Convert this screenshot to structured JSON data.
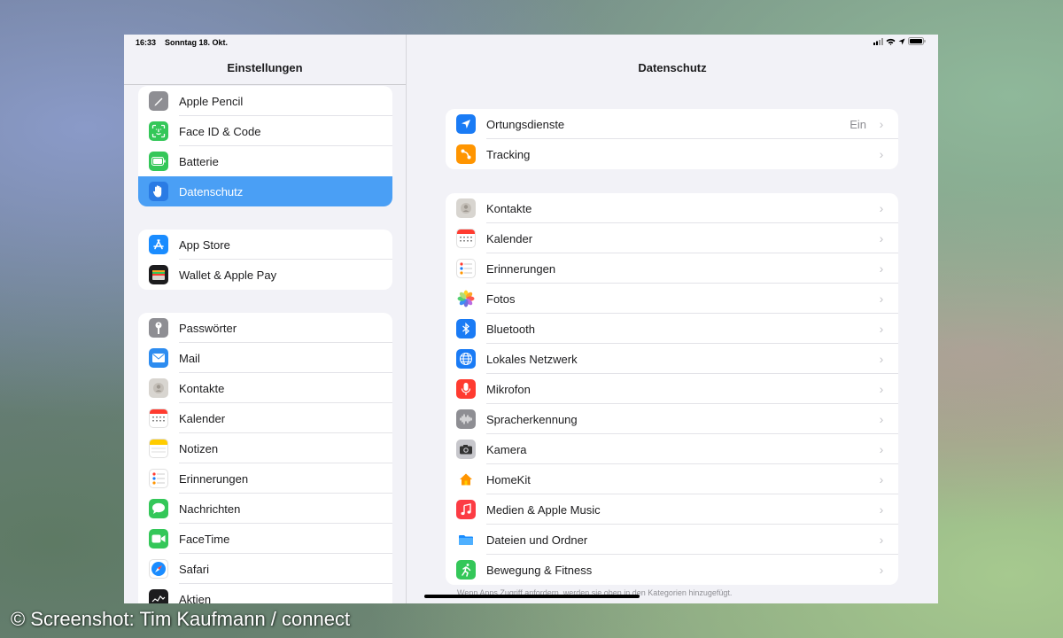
{
  "status_bar": {
    "time": "16:33",
    "date": "Sonntag 18. Okt."
  },
  "sidebar": {
    "title": "Einstellungen",
    "groups": [
      [
        {
          "label": "Apple Pencil",
          "icon": "pencil-icon",
          "color": "#8e8e93"
        },
        {
          "label": "Face ID & Code",
          "icon": "faceid-icon",
          "color": "#34c759"
        },
        {
          "label": "Batterie",
          "icon": "battery-icon",
          "color": "#34c759"
        },
        {
          "label": "Datenschutz",
          "icon": "hand-icon",
          "color": "#2a7be4",
          "selected": true
        }
      ],
      [
        {
          "label": "App Store",
          "icon": "appstore-icon",
          "color": "#1a8cff"
        },
        {
          "label": "Wallet & Apple Pay",
          "icon": "wallet-icon",
          "color": "#1c1c1e"
        }
      ],
      [
        {
          "label": "Passwörter",
          "icon": "key-icon",
          "color": "#8e8e93"
        },
        {
          "label": "Mail",
          "icon": "mail-icon",
          "color": "#2d8cf0"
        },
        {
          "label": "Kontakte",
          "icon": "contacts-icon",
          "color": "#d8d5d0"
        },
        {
          "label": "Kalender",
          "icon": "calendar-icon",
          "color": "#ffffff"
        },
        {
          "label": "Notizen",
          "icon": "notes-icon",
          "color": "#ffffff"
        },
        {
          "label": "Erinnerungen",
          "icon": "reminders-icon",
          "color": "#ffffff"
        },
        {
          "label": "Nachrichten",
          "icon": "messages-icon",
          "color": "#34c759"
        },
        {
          "label": "FaceTime",
          "icon": "facetime-icon",
          "color": "#34c759"
        },
        {
          "label": "Safari",
          "icon": "safari-icon",
          "color": "#ffffff"
        },
        {
          "label": "Aktien",
          "icon": "stocks-icon",
          "color": "#1c1c1e"
        }
      ]
    ]
  },
  "main": {
    "title": "Datenschutz",
    "groups": [
      [
        {
          "label": "Ortungsdienste",
          "icon": "location-arrow-icon",
          "color": "#1a7bf5",
          "value": "Ein"
        },
        {
          "label": "Tracking",
          "icon": "tracking-icon",
          "color": "#ff9500"
        }
      ],
      [
        {
          "label": "Kontakte",
          "icon": "contacts-icon",
          "color": "#d8d5d0"
        },
        {
          "label": "Kalender",
          "icon": "calendar-icon",
          "color": "#ffffff"
        },
        {
          "label": "Erinnerungen",
          "icon": "reminders-icon",
          "color": "#ffffff"
        },
        {
          "label": "Fotos",
          "icon": "photos-icon",
          "color": "#ffffff"
        },
        {
          "label": "Bluetooth",
          "icon": "bluetooth-icon",
          "color": "#1a7bf5"
        },
        {
          "label": "Lokales Netzwerk",
          "icon": "globe-icon",
          "color": "#1a7bf5"
        },
        {
          "label": "Mikrofon",
          "icon": "microphone-icon",
          "color": "#ff3b30"
        },
        {
          "label": "Spracherkennung",
          "icon": "waveform-icon",
          "color": "#8e8e93"
        },
        {
          "label": "Kamera",
          "icon": "camera-icon",
          "color": "#8e8e93"
        },
        {
          "label": "HomeKit",
          "icon": "home-icon",
          "color": "#ffffff"
        },
        {
          "label": "Medien & Apple Music",
          "icon": "music-icon",
          "color": "#fc3c44"
        },
        {
          "label": "Dateien und Ordner",
          "icon": "folder-icon",
          "color": "#ffffff"
        },
        {
          "label": "Bewegung & Fitness",
          "icon": "fitness-icon",
          "color": "#34c759"
        }
      ]
    ],
    "footnote": "Wenn Apps Zugriff anfordern, werden sie oben in den Kategorien hinzugefügt."
  },
  "watermark": "© Screenshot: Tim Kaufmann / connect"
}
